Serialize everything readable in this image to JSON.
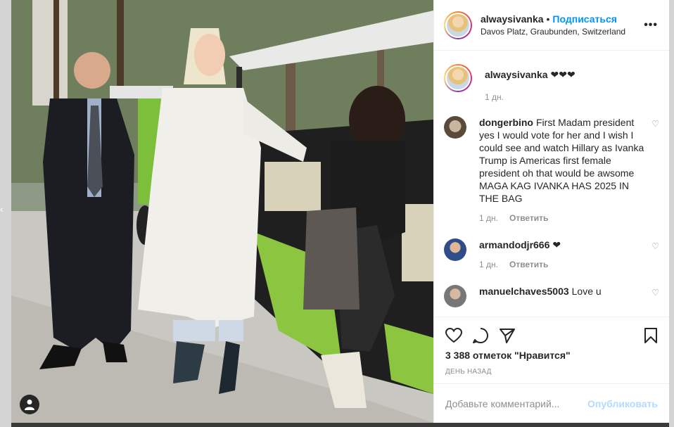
{
  "post": {
    "username": "alwaysivanka",
    "follow_label": "Подписаться",
    "separator": "•",
    "location": "Davos Platz, Graubunden, Switzerland",
    "more_icon": "more-horizontal-icon"
  },
  "caption": {
    "username": "alwaysivanka",
    "text": "❤❤❤",
    "time": "1 дн."
  },
  "comments": [
    {
      "username": "dongerbino",
      "text": "First Madam president yes I would vote for her and I wish I could see and watch Hillary as Ivanka Trump is Americas first female president oh that would be awsome MAGA KAG IVANKA HAS 2025 IN THE BAG",
      "time": "1 дн.",
      "reply": "Ответить"
    },
    {
      "username": "armandodjr666",
      "text": "❤",
      "time": "1 дн.",
      "reply": "Ответить"
    },
    {
      "username": "manuelchaves5003",
      "text": "Love u",
      "time": "",
      "reply": ""
    }
  ],
  "actions": {
    "likes": "3 388 отметок \"Нравится\"",
    "date": "День назад"
  },
  "add_comment": {
    "placeholder": "Добавьте комментарий...",
    "post_label": "Опубликовать"
  },
  "colors": {
    "link_blue": "#0095f6",
    "muted": "#8e8e8e",
    "post_disabled": "#b3dbff"
  }
}
